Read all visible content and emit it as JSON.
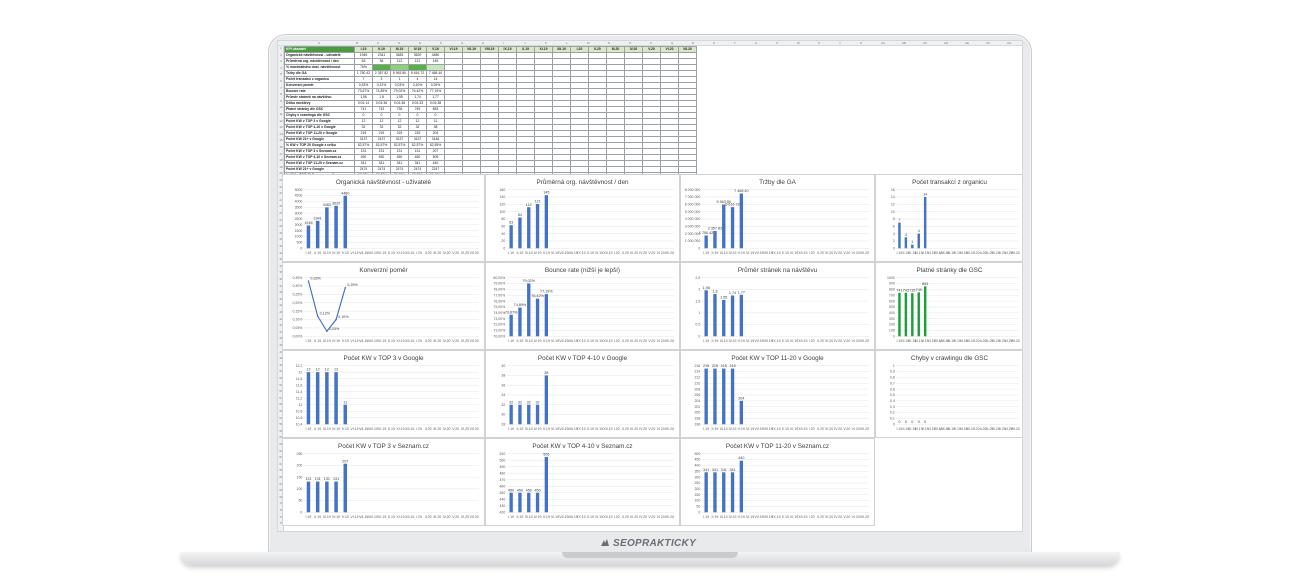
{
  "brand": {
    "text": "SEOPRAKTICKY",
    "icon": "brand-logo-icon"
  },
  "sheet": {
    "column_letters": [
      "A",
      "B",
      "C",
      "D",
      "E",
      "F",
      "G",
      "H",
      "I",
      "J",
      "K",
      "L",
      "M",
      "N",
      "O",
      "P",
      "Q",
      "R",
      "S",
      "T",
      "U",
      "V",
      "W",
      "X",
      "Y",
      "Z",
      "AA",
      "AB",
      "AC",
      "AD",
      "AE",
      "AF",
      "AG",
      "AH"
    ],
    "header_label": "KPI ukazatel",
    "months": [
      "I.19",
      "II.19",
      "III.19",
      "IV.19",
      "V.19",
      "VI.19",
      "VII.19",
      "VIII.19",
      "IX.19",
      "X.19",
      "XI.19",
      "XII.19",
      "I.20",
      "II.20",
      "III.20",
      "IV.20",
      "V.20",
      "VI.20",
      "VII.20"
    ],
    "rows": [
      {
        "label": "Organické návštěvnost - uživatelé",
        "values": [
          "1945",
          "2341",
          "3483",
          "3620",
          "4480"
        ]
      },
      {
        "label": "Průměrná org. návštěvnost / den",
        "values": [
          "63",
          "84",
          "112",
          "121",
          "145"
        ]
      },
      {
        "label": "% maximálního dosl. návštěvnost",
        "values": [
          "76%",
          "",
          "",
          "",
          ""
        ],
        "fills": [
          "",
          "g1",
          "g2",
          "g1",
          "g3"
        ]
      },
      {
        "label": "Tržby dle GA",
        "values": [
          "1 750 42",
          "2 357 82",
          "5 963 80",
          "5 616 72",
          "7 468 40"
        ]
      },
      {
        "label": "Počet transakcí z organicu",
        "values": [
          "7",
          "3",
          "1",
          "4",
          "14"
        ]
      },
      {
        "label": "Konverzní poměr",
        "values": [
          "0,33%",
          "0,12%",
          "0,03%",
          "0,10%",
          "0,29%"
        ]
      },
      {
        "label": "Bounce rate",
        "values": [
          "73,67%",
          "74,89%",
          "79,02%",
          "76,42%",
          "77,19%"
        ]
      },
      {
        "label": "Průměr stránek na návštěvu",
        "values": [
          "1,96",
          "1,8",
          "1,55",
          "1,74",
          "1,77"
        ]
      },
      {
        "label": "Délka návštěvy",
        "values": [
          "0:01:14",
          "0:01:36",
          "0:01:36",
          "0:01:33",
          "0:01:38"
        ]
      },
      {
        "label": "Platné stránky dle GSC",
        "values": [
          "741",
          "743",
          "735",
          "749",
          "853"
        ]
      },
      {
        "label": "Chyby v crawlingu dle GSC",
        "values": [
          "0",
          "0",
          "0",
          "0",
          "0"
        ]
      },
      {
        "label": "Počet KW v TOP 3 v Google",
        "values": [
          "12",
          "12",
          "12",
          "12",
          "11"
        ]
      },
      {
        "label": "Počet KW v TOP 4-10 v Google",
        "values": [
          "32",
          "32",
          "32",
          "32",
          "38"
        ]
      },
      {
        "label": "Počet KW v TOP 11-20 v Google",
        "values": [
          "215",
          "215",
          "215",
          "215",
          "204"
        ]
      },
      {
        "label": "Počet KW 21+ v Google",
        "values": [
          "3137",
          "3137",
          "3137",
          "3137",
          "3146"
        ]
      },
      {
        "label": "% KW v TOP 20 Google z celku",
        "values": [
          "52,57%",
          "52,57%",
          "52,57%",
          "52,57%",
          "52,55%"
        ]
      },
      {
        "label": "Počet KW v TOP 3 v Seznam.cz",
        "values": [
          "131",
          "131",
          "131",
          "131",
          "207"
        ]
      },
      {
        "label": "Počet KW v TOP 4-10 v Seznam.cz",
        "values": [
          "450",
          "450",
          "450",
          "450",
          "505"
        ]
      },
      {
        "label": "Počet KW v TOP 11-20 v Seznam.cz",
        "values": [
          "341",
          "341",
          "341",
          "341",
          "440"
        ]
      },
      {
        "label": "Počet KW 21+ v Google",
        "values": [
          "2474",
          "2474",
          "2474",
          "2474",
          "2247"
        ]
      },
      {
        "label": "% KW v TOP 20 Seznam z celku",
        "values": [
          "37,27%",
          "37,27%",
          "37,27%",
          "37,27%",
          "53,18%"
        ]
      }
    ]
  },
  "chart_data": [
    {
      "type": "bar",
      "title": "Organická návštěvnost - uživatelé",
      "categories": [
        "I.19",
        "II.19",
        "III.19",
        "IV.19",
        "V.19",
        "VI.19",
        "VII.19",
        "VIII.19",
        "IX.19",
        "X.19",
        "XI.19",
        "XII.19",
        "I.20",
        "II.20",
        "III.20",
        "IV.20",
        "V.20",
        "VI.20",
        "VII.20"
      ],
      "values": [
        1945,
        2341,
        3483,
        3620,
        4480
      ],
      "labels": [
        "1945",
        "2341",
        "3483",
        "3620",
        "4480"
      ],
      "ylim": [
        0,
        5000
      ],
      "yticks": [
        "0",
        "500",
        "1000",
        "1500",
        "2000",
        "2500",
        "3000",
        "3500",
        "4000",
        "4500",
        "5000"
      ],
      "color": "#4472c4"
    },
    {
      "type": "bar",
      "title": "Průměrná org. návštěvnost / den",
      "categories": [
        "I.19",
        "II.19",
        "III.19",
        "IV.19",
        "V.19",
        "VI.19",
        "VII.19",
        "VIII.19",
        "IX.19",
        "X.19",
        "XI.19",
        "XII.19",
        "I.20",
        "II.20",
        "III.20",
        "IV.20",
        "V.20",
        "VI.20",
        "VII.20"
      ],
      "values": [
        63,
        84,
        112,
        121,
        145
      ],
      "labels": [
        "63",
        "84",
        "112",
        "121",
        "145"
      ],
      "ylim": [
        0,
        160
      ],
      "yticks": [
        "0",
        "20",
        "40",
        "60",
        "80",
        "100",
        "120",
        "140",
        "160"
      ],
      "color": "#4472c4"
    },
    {
      "type": "bar",
      "title": "Tržby dle GA",
      "categories": [
        "I.19",
        "II.19",
        "III.19",
        "IV.19",
        "V.19",
        "VI.19",
        "VII.19",
        "VIII.19",
        "IX.19",
        "X.19",
        "XI.19",
        "XII.19",
        "I.20",
        "II.20",
        "III.20",
        "IV.20",
        "V.20",
        "VI.20",
        "VII.20"
      ],
      "values": [
        1750420,
        2357820,
        5963800,
        5616720,
        7468400
      ],
      "labels": [
        "1 750 42",
        "2 357 82",
        "5 963 80",
        "5 616 72",
        "7 468 40"
      ],
      "ylim": [
        0,
        8000000
      ],
      "yticks": [
        "0",
        "1 000 000",
        "2 000 000",
        "3 000 000",
        "4 000 000",
        "5 000 000",
        "6 000 000",
        "7 000 000",
        "8 000 000"
      ],
      "color": "#4472c4"
    },
    {
      "type": "bar",
      "title": "Počet transakcí z organicu",
      "categories": [
        "I.19",
        "II.19",
        "III.19",
        "IV.19",
        "V.19",
        "VI.19",
        "VII.19",
        "VIII.19",
        "IX.19",
        "X.19",
        "XI.19",
        "XII.19",
        "I.20",
        "II.20",
        "III.20",
        "IV.20",
        "V.20",
        "VI.20",
        "VII.20"
      ],
      "values": [
        7,
        3,
        1,
        4,
        14
      ],
      "labels": [
        "7",
        "3",
        "1",
        "4",
        "14"
      ],
      "ylim": [
        0,
        16
      ],
      "yticks": [
        "0",
        "2",
        "4",
        "6",
        "8",
        "10",
        "12",
        "14",
        "16"
      ],
      "color": "#4472c4"
    },
    {
      "type": "line",
      "title": "Konverzní poměr",
      "categories": [
        "I.19",
        "II.19",
        "III.19",
        "IV.19",
        "V.19",
        "VI.19",
        "VII.19",
        "VIII.19",
        "IX.19",
        "X.19",
        "XI.19",
        "XII.19",
        "I.20",
        "II.20",
        "III.20",
        "IV.20",
        "V.20",
        "VI.20",
        "VII.20"
      ],
      "values": [
        0.33,
        0.12,
        0.03,
        0.1,
        0.29
      ],
      "labels": [
        "0,33%",
        "0,12%",
        "0,03%",
        "0,10%",
        "0,29%"
      ],
      "ylim": [
        0,
        0.35
      ],
      "yticks": [
        "0,00%",
        "0,05%",
        "0,10%",
        "0,15%",
        "0,20%",
        "0,25%",
        "0,30%",
        "0,35%"
      ],
      "color": "#4472c4"
    },
    {
      "type": "bar",
      "title": "Bounce rate (nižší je lepší)",
      "categories": [
        "I.19",
        "II.19",
        "III.19",
        "IV.19",
        "V.19",
        "VI.19",
        "VII.19",
        "VIII.19",
        "IX.19",
        "X.19",
        "XI.19",
        "XII.19",
        "I.20",
        "II.20",
        "III.20",
        "IV.20",
        "V.20",
        "VI.20",
        "VII.20"
      ],
      "values": [
        73.67,
        74.89,
        79.02,
        76.42,
        77.19
      ],
      "labels": [
        "73,67%",
        "74,89%",
        "79,02%",
        "76,42%",
        "77,19%"
      ],
      "ylim": [
        70,
        80
      ],
      "yticks": [
        "70,00%",
        "71,00%",
        "72,00%",
        "73,00%",
        "74,00%",
        "75,00%",
        "76,00%",
        "77,00%",
        "78,00%",
        "79,00%",
        "80,00%"
      ],
      "color": "#4472c4"
    },
    {
      "type": "bar",
      "title": "Průměr stránek na návštěvu",
      "categories": [
        "I.19",
        "II.19",
        "III.19",
        "IV.19",
        "V.19",
        "VI.19",
        "VII.19",
        "VIII.19",
        "IX.19",
        "X.19",
        "XI.19",
        "XII.19",
        "I.20",
        "II.20",
        "III.20",
        "IV.20",
        "V.20",
        "VI.20",
        "VII.20"
      ],
      "values": [
        1.96,
        1.8,
        1.55,
        1.74,
        1.77
      ],
      "labels": [
        "1,96",
        "1,8",
        "1,55",
        "1,74",
        "1,77"
      ],
      "ylim": [
        0,
        2.5
      ],
      "yticks": [
        "0",
        "0,5",
        "1",
        "1,5",
        "2",
        "2,5"
      ],
      "color": "#4472c4"
    },
    {
      "type": "bar",
      "title": "Platné stránky dle GSC",
      "categories": [
        "I.19",
        "II.19",
        "III.19",
        "IV.19",
        "V.19",
        "VI.19",
        "VII.19",
        "VIII.19",
        "IX.19",
        "X.19",
        "XI.19",
        "XII.19",
        "I.20",
        "II.20",
        "III.20",
        "IV.20",
        "V.20",
        "VI.20",
        "VII.20"
      ],
      "values": [
        741,
        743,
        735,
        749,
        853
      ],
      "labels": [
        "741",
        "743",
        "735",
        "749",
        "853"
      ],
      "ylim": [
        0,
        1000
      ],
      "yticks": [
        "0",
        "100",
        "200",
        "300",
        "400",
        "500",
        "600",
        "700",
        "800",
        "900",
        "1000"
      ],
      "color": "#1e9e3a"
    },
    {
      "type": "bar",
      "title": "Počet KW v TOP 3 v Google",
      "categories": [
        "I.19",
        "II.19",
        "III.19",
        "IV.19",
        "V.19",
        "VI.19",
        "VII.19",
        "VIII.19",
        "IX.19",
        "X.19",
        "XI.19",
        "XII.19",
        "I.20",
        "II.20",
        "III.20",
        "IV.20",
        "V.20",
        "VI.20",
        "VII.20"
      ],
      "values": [
        12,
        12,
        12,
        12,
        11
      ],
      "labels": [
        "12",
        "12",
        "12",
        "12",
        "11"
      ],
      "ylim": [
        10.4,
        12.2
      ],
      "yticks": [
        "10,4",
        "10,6",
        "10,8",
        "11",
        "11,2",
        "11,4",
        "11,6",
        "11,8",
        "12",
        "12,2"
      ],
      "color": "#4472c4"
    },
    {
      "type": "bar",
      "title": "Počet KW v TOP 4-10 v Google",
      "categories": [
        "I.19",
        "II.19",
        "III.19",
        "IV.19",
        "V.19",
        "VI.19",
        "VII.19",
        "VIII.19",
        "IX.19",
        "X.19",
        "XI.19",
        "XII.19",
        "I.20",
        "II.20",
        "III.20",
        "IV.20",
        "V.20",
        "VI.20",
        "VII.20"
      ],
      "values": [
        32,
        32,
        32,
        32,
        38
      ],
      "labels": [
        "32",
        "32",
        "32",
        "32",
        "38"
      ],
      "ylim": [
        28,
        40
      ],
      "yticks": [
        "28",
        "30",
        "32",
        "34",
        "36",
        "38",
        "40"
      ],
      "color": "#4472c4"
    },
    {
      "type": "bar",
      "title": "Počet KW v  TOP 11-20 v Google",
      "categories": [
        "I.19",
        "II.19",
        "III.19",
        "IV.19",
        "V.19",
        "VI.19",
        "VII.19",
        "VIII.19",
        "IX.19",
        "X.19",
        "XI.19",
        "XII.19",
        "I.20",
        "II.20",
        "III.20",
        "IV.20",
        "V.20",
        "VI.20",
        "VII.20"
      ],
      "values": [
        215,
        215,
        215,
        215,
        204
      ],
      "labels": [
        "215",
        "215",
        "215",
        "215",
        "204"
      ],
      "ylim": [
        196,
        216
      ],
      "yticks": [
        "196",
        "198",
        "200",
        "202",
        "204",
        "206",
        "208",
        "210",
        "212",
        "214",
        "216"
      ],
      "color": "#4472c4"
    },
    {
      "type": "bar",
      "title": "Chyby v crawlingu dle GSC",
      "categories": [
        "I.19",
        "II.19",
        "III.19",
        "IV.19",
        "V.19",
        "VI.19",
        "VII.19",
        "VIII.19",
        "IX.19",
        "X.19",
        "XI.19",
        "XII.19",
        "I.20",
        "II.20",
        "III.20",
        "IV.20",
        "V.20",
        "VI.20",
        "VII.20"
      ],
      "values": [
        0,
        0,
        0,
        0,
        0
      ],
      "labels": [
        "0",
        "0",
        "0",
        "0",
        "0"
      ],
      "ylim": [
        0,
        1
      ],
      "yticks": [
        "0",
        "0,1",
        "0,2",
        "0,3",
        "0,4",
        "0,5",
        "0,6",
        "0,7",
        "0,8",
        "0,9",
        "1"
      ],
      "color": "#4472c4"
    },
    {
      "type": "bar",
      "title": "Počet KW v TOP 3 v Seznam.cz",
      "categories": [
        "I.19",
        "II.19",
        "III.19",
        "IV.19",
        "V.19",
        "VI.19",
        "VII.19",
        "VIII.19",
        "IX.19",
        "X.19",
        "XI.19",
        "XII.19",
        "I.20",
        "II.20",
        "III.20",
        "IV.20",
        "V.20",
        "VI.20",
        "VII.20"
      ],
      "values": [
        131,
        131,
        131,
        131,
        207
      ],
      "labels": [
        "131",
        "131",
        "131",
        "131",
        "207"
      ],
      "ylim": [
        0,
        250
      ],
      "yticks": [
        "0",
        "50",
        "100",
        "150",
        "200",
        "250"
      ],
      "color": "#4472c4"
    },
    {
      "type": "bar",
      "title": "Počet KW v  TOP 4-10 v Seznam.cz",
      "categories": [
        "I.19",
        "II.19",
        "III.19",
        "IV.19",
        "V.19",
        "VI.19",
        "VII.19",
        "VIII.19",
        "IX.19",
        "X.19",
        "XI.19",
        "XII.19",
        "I.20",
        "II.20",
        "III.20",
        "IV.20",
        "V.20",
        "VI.20",
        "VII.20"
      ],
      "values": [
        450,
        450,
        450,
        450,
        505
      ],
      "labels": [
        "450",
        "450",
        "450",
        "450",
        "505"
      ],
      "ylim": [
        420,
        510
      ],
      "yticks": [
        "420",
        "430",
        "440",
        "450",
        "460",
        "470",
        "480",
        "490",
        "500",
        "510"
      ],
      "color": "#4472c4"
    },
    {
      "type": "bar",
      "title": "Počet KW v  TOP 11-20 v Seznam.cz",
      "categories": [
        "I.19",
        "II.19",
        "III.19",
        "IV.19",
        "V.19",
        "VI.19",
        "VII.19",
        "VIII.19",
        "IX.19",
        "X.19",
        "XI.19",
        "XII.19",
        "I.20",
        "II.20",
        "III.20",
        "IV.20",
        "V.20",
        "VI.20",
        "VII.20"
      ],
      "values": [
        341,
        341,
        341,
        341,
        440
      ],
      "labels": [
        "341",
        "341",
        "341",
        "341",
        "440"
      ],
      "ylim": [
        0,
        500
      ],
      "yticks": [
        "0",
        "50",
        "100",
        "150",
        "200",
        "250",
        "300",
        "350",
        "400",
        "450",
        "500"
      ],
      "color": "#4472c4"
    }
  ]
}
